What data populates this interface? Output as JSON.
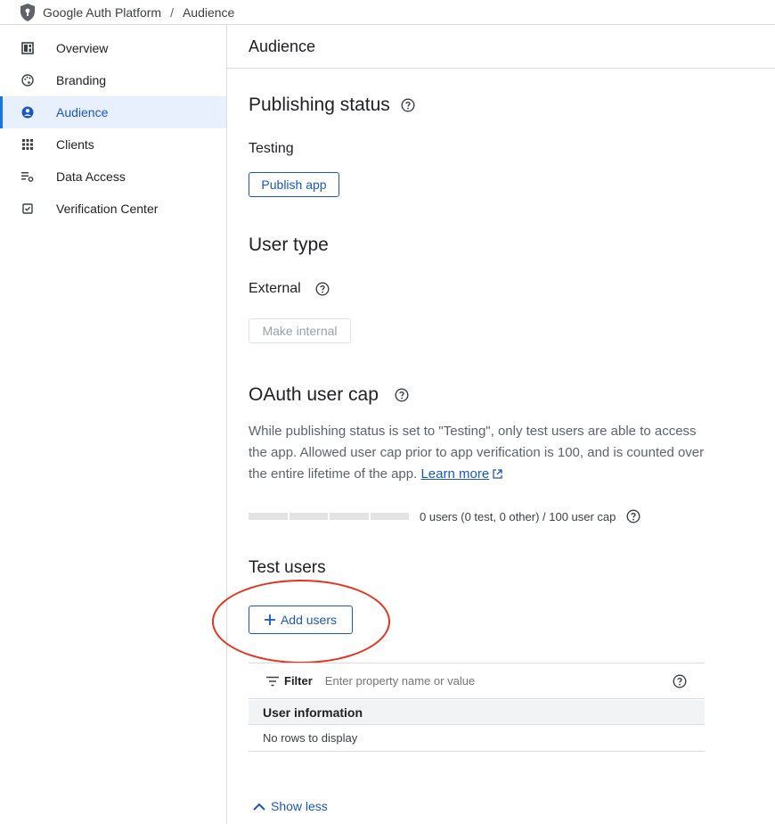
{
  "breadcrumb": {
    "app": "Google Auth Platform",
    "separator": "/",
    "current": "Audience"
  },
  "sidebar": {
    "items": [
      {
        "label": "Overview",
        "icon": "dashboard-icon"
      },
      {
        "label": "Branding",
        "icon": "palette-icon"
      },
      {
        "label": "Audience",
        "icon": "account-circle-icon",
        "active": true
      },
      {
        "label": "Clients",
        "icon": "apps-grid-icon"
      },
      {
        "label": "Data Access",
        "icon": "list-settings-icon"
      },
      {
        "label": "Verification Center",
        "icon": "checkbox-icon"
      }
    ]
  },
  "page": {
    "title": "Audience"
  },
  "publishing": {
    "heading": "Publishing status",
    "status": "Testing",
    "publish_button": "Publish app"
  },
  "user_type": {
    "heading": "User type",
    "value": "External",
    "make_internal_button": "Make internal"
  },
  "oauth_cap": {
    "heading": "OAuth user cap",
    "description": "While publishing status is set to \"Testing\", only test users are able to access the app. Allowed user cap prior to app verification is 100, and is counted over the entire lifetime of the app.",
    "learn_more": "Learn more",
    "usage_text": "0 users (0 test, 0 other) / 100 user cap",
    "usage_fraction": 0
  },
  "test_users": {
    "heading": "Test users",
    "add_button": "Add users",
    "filter_label": "Filter",
    "filter_placeholder": "Enter property name or value",
    "column_header": "User information",
    "empty_text": "No rows to display"
  },
  "footer": {
    "show_less": "Show less"
  },
  "colors": {
    "accent": "#1a56c4",
    "annotation": "#e8321c",
    "active_bg": "#e8f0fe"
  }
}
